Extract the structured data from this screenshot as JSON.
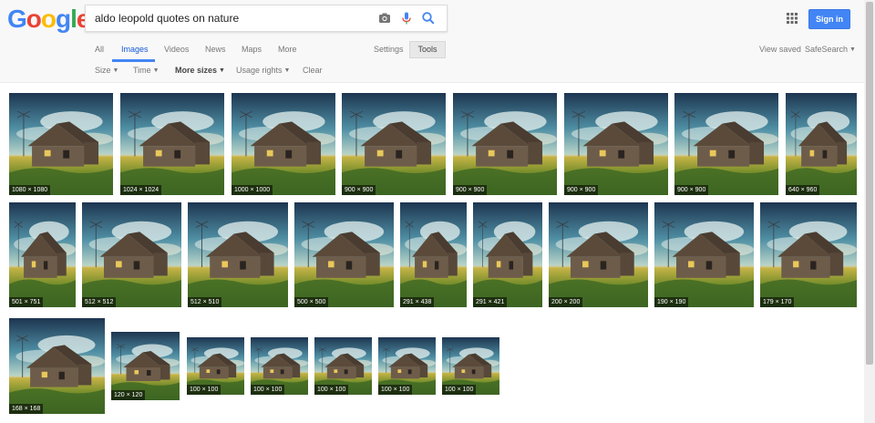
{
  "logo": {
    "letters": [
      {
        "ch": "G",
        "color": "#4285f4"
      },
      {
        "ch": "o",
        "color": "#ea4335"
      },
      {
        "ch": "o",
        "color": "#fbbc05"
      },
      {
        "ch": "g",
        "color": "#4285f4"
      },
      {
        "ch": "l",
        "color": "#34a853"
      },
      {
        "ch": "e",
        "color": "#ea4335"
      }
    ]
  },
  "search": {
    "query": "aldo leopold quotes on nature",
    "camera_icon": "camera-icon",
    "mic_icon": "microphone-icon",
    "search_icon": "search-icon"
  },
  "header": {
    "apps_icon": "apps-grid-icon",
    "signin_label": "Sign in"
  },
  "nav": {
    "tabs": [
      "All",
      "Images",
      "Videos",
      "News",
      "Maps",
      "More"
    ],
    "active": "Images",
    "settings": "Settings",
    "tools": "Tools",
    "view_saved": "View saved",
    "safesearch": "SafeSearch"
  },
  "filters": {
    "items": [
      "Size",
      "Time",
      "More sizes",
      "Usage rights",
      "Clear"
    ]
  },
  "colors": {
    "accent": "#4285f4",
    "header_bg": "#f8f8f8"
  },
  "images": [
    {
      "dims": "1080 × 1080"
    },
    {
      "dims": "1024 × 1024"
    },
    {
      "dims": "1000 × 1000"
    },
    {
      "dims": "900 × 900"
    },
    {
      "dims": "900 × 900"
    },
    {
      "dims": "900 × 900"
    },
    {
      "dims": "900 × 900"
    },
    {
      "dims": "640 × 960"
    },
    {
      "dims": "501 × 751"
    },
    {
      "dims": "512 × 512"
    },
    {
      "dims": "512 × 510"
    },
    {
      "dims": "500 × 500"
    },
    {
      "dims": "291 × 438"
    },
    {
      "dims": "291 × 421"
    },
    {
      "dims": "200 × 200"
    },
    {
      "dims": "190 × 190"
    },
    {
      "dims": "179 × 170"
    },
    {
      "dims": "168 × 168"
    },
    {
      "dims": "120 × 120"
    },
    {
      "dims": "100 × 100"
    },
    {
      "dims": "100 × 100"
    },
    {
      "dims": "100 × 100"
    },
    {
      "dims": "100 × 100"
    },
    {
      "dims": "100 × 100"
    }
  ]
}
